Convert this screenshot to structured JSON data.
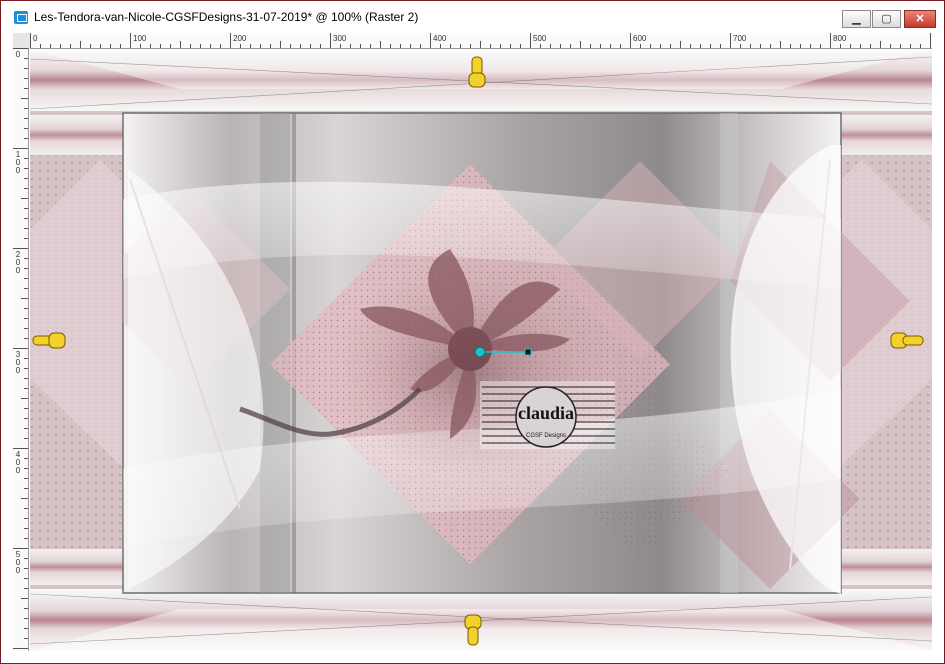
{
  "window": {
    "title": "Les-Tendora-van-Nicole-CGSFDesigns-31-07-2019* @ 100% (Raster 2)",
    "buttons": {
      "minimize": "▁",
      "maximize": "▢",
      "close": "✕"
    }
  },
  "ruler": {
    "top_labels": [
      "0",
      "100",
      "200",
      "300",
      "400",
      "500",
      "600",
      "700",
      "800"
    ],
    "left_labels": [
      "0",
      "1 0 0",
      "2 0 0",
      "3 0 0",
      "4 0 0",
      "5 0 0"
    ]
  },
  "canvas": {
    "watermark_text": "claudia",
    "watermark_subtext": "CGSF Designs",
    "colors": {
      "rose": "#c8a0a6",
      "mauve": "#8a5a62",
      "grey": "#9a9a9a",
      "white": "#f4f2f2"
    },
    "markers": {
      "top": "hand-pointing-down-icon",
      "bottom": "hand-pointing-up-icon",
      "left": "hand-pointing-right-icon",
      "right": "hand-pointing-left-icon"
    }
  }
}
